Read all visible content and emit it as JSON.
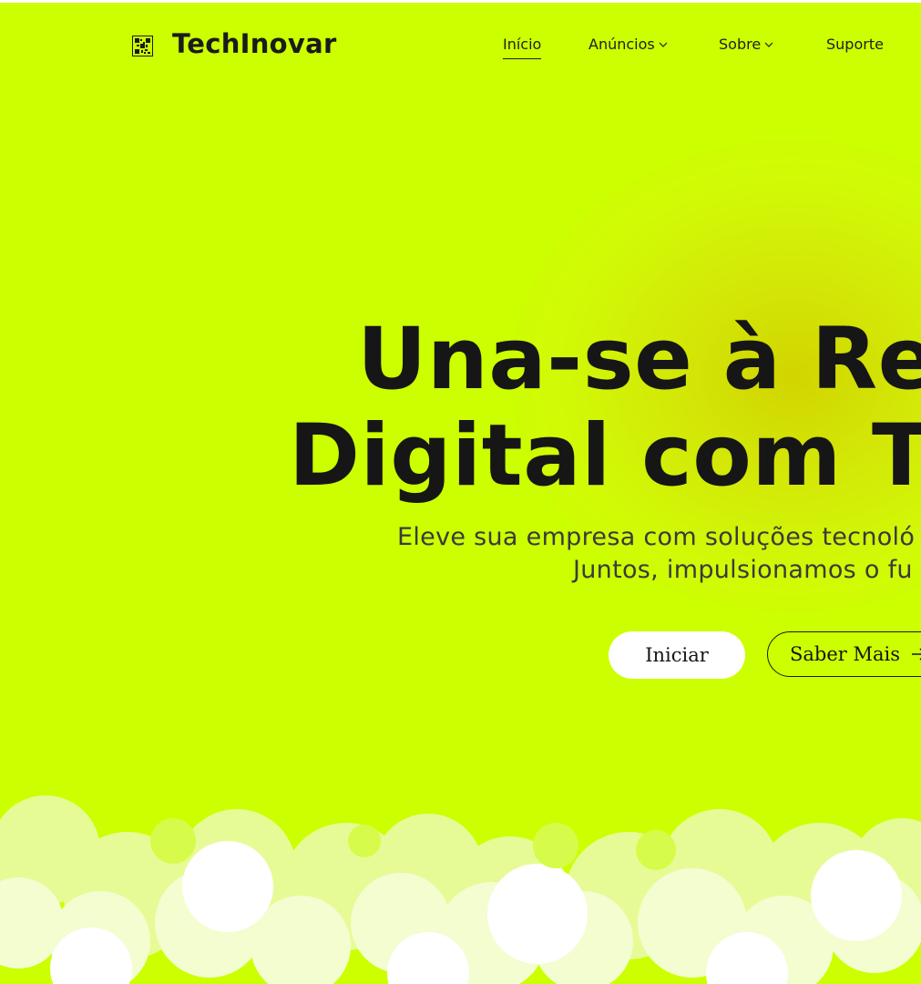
{
  "brand": {
    "name": "TechInovar",
    "icon": "qr-code-icon"
  },
  "nav": {
    "items": [
      {
        "label": "Início",
        "active": true
      },
      {
        "label": "Anúncios",
        "dropdown": true
      },
      {
        "label": "Sobre",
        "dropdown": true
      },
      {
        "label": "Suporte"
      }
    ]
  },
  "hero": {
    "title_line1": "Una-se à Revo",
    "title_line2": "Digital com Tec",
    "subtitle_line1": "Eleve sua empresa com soluções tecnoló",
    "subtitle_line2": "Juntos, impulsionamos o fu"
  },
  "buttons": {
    "primary": "Iniciar",
    "secondary": "Saber Mais",
    "secondary_icon": "arrow-right-icon"
  },
  "colors": {
    "background": "#ccff00",
    "glow": "#d4d400",
    "text": "#161616",
    "primary_button": "#ffffff"
  }
}
